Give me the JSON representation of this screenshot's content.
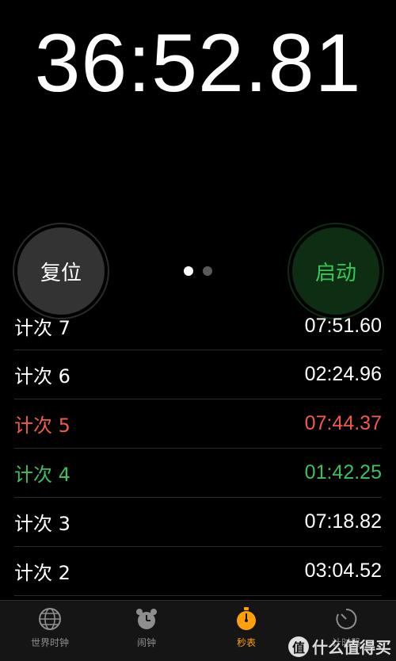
{
  "stopwatch": {
    "elapsed": "36:52.81"
  },
  "controls": {
    "reset_label": "复位",
    "start_label": "启动"
  },
  "pager": {
    "active_index": 0,
    "count": 2
  },
  "laps": [
    {
      "label": "计次 7",
      "time": "07:51.60",
      "style": "normal"
    },
    {
      "label": "计次 6",
      "time": "02:24.96",
      "style": "normal"
    },
    {
      "label": "计次 5",
      "time": "07:44.37",
      "style": "slowest"
    },
    {
      "label": "计次 4",
      "time": "01:42.25",
      "style": "fastest"
    },
    {
      "label": "计次 3",
      "time": "07:18.82",
      "style": "normal"
    },
    {
      "label": "计次 2",
      "time": "03:04.52",
      "style": "normal"
    }
  ],
  "tabs": [
    {
      "label": "世界时钟",
      "icon": "globe-icon",
      "active": false
    },
    {
      "label": "闹钟",
      "icon": "alarm-clock-icon",
      "active": false
    },
    {
      "label": "秒表",
      "icon": "stopwatch-icon",
      "active": true
    },
    {
      "label": "计时器",
      "icon": "timer-icon",
      "active": false
    }
  ],
  "watermark": {
    "text": "什么值得买",
    "badge": "值"
  },
  "colors": {
    "accent": "#ff9f0a",
    "start_green": "#36c75a",
    "slowest_red": "#f05a4b",
    "fastest_green": "#3fbf5c"
  }
}
